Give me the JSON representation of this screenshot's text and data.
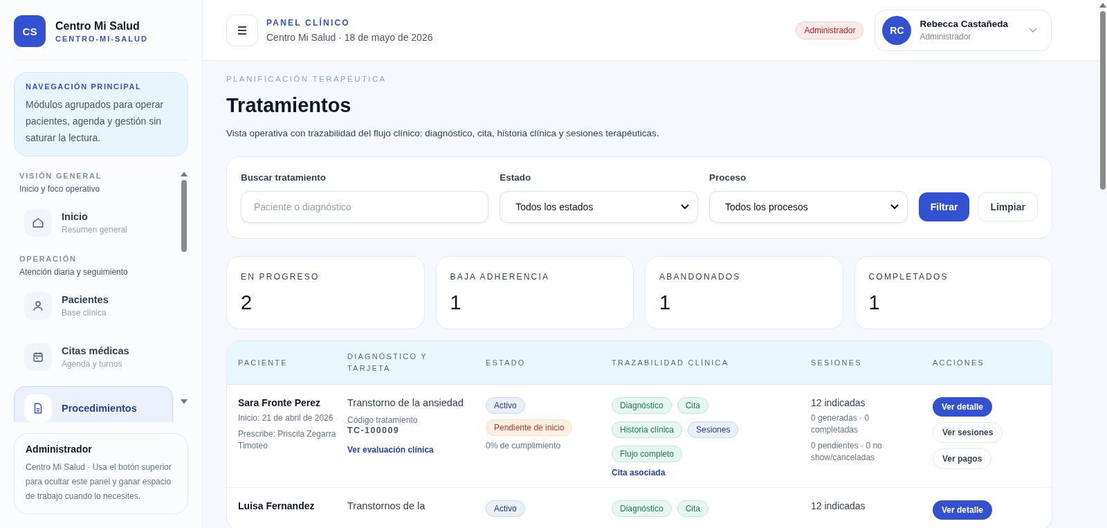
{
  "brand": {
    "initials": "CS",
    "name": "Centro Mi Salud",
    "slug": "CENTRO-MI-SALUD"
  },
  "nav_intro": {
    "title": "NAVEGACIÓN PRINCIPAL",
    "text": "Módulos agrupados para operar pacientes, agenda y gestión sin saturar la lectura."
  },
  "nav_sections": [
    {
      "title": "VISIÓN GENERAL",
      "subtitle": "Inicio y foco operativo",
      "items": [
        {
          "kind": "home",
          "label": "Inicio",
          "sub": "Resumen general",
          "selected": false
        }
      ]
    },
    {
      "title": "OPERACIÓN",
      "subtitle": "Atención diaria y seguimiento",
      "items": [
        {
          "kind": "user",
          "label": "Pacientes",
          "sub": "Base clínica",
          "selected": false
        },
        {
          "kind": "calendar",
          "label": "Citas médicas",
          "sub": "Agenda y turnos",
          "selected": false
        },
        {
          "kind": "document",
          "label": "Procedimientos",
          "selected": true
        }
      ]
    }
  ],
  "sidebar_footer": {
    "title": "Administrador",
    "text": "Centro Mi Salud · Usa el botón superior para ocultar este panel y ganar espacio de trabajo cuando lo necesites."
  },
  "header": {
    "eyebrow": "PANEL CLÍNICO",
    "subtitle": "Centro Mi Salud · 18 de mayo de 2026",
    "role_badge": "Administrador",
    "user": {
      "initials": "RC",
      "name": "Rebecca Castañeda",
      "role": "Administrador"
    }
  },
  "page": {
    "eyebrow": "PLANIFICACIÓN TERAPÉUTICA",
    "title": "Tratamientos",
    "description": "Vista operativa con trazabilidad del flujo clínico: diagnóstico, cita, historia clínica y sesiones terapéuticas."
  },
  "filters": {
    "search": {
      "label": "Buscar tratamiento",
      "placeholder": "Paciente o diagnóstico"
    },
    "selects": [
      {
        "label": "Estado",
        "value": "Todos los estados"
      },
      {
        "label": "Proceso",
        "value": "Todos los procesos"
      }
    ],
    "buttons": [
      {
        "label": "Filtrar",
        "kind": "primary"
      },
      {
        "label": "Limpiar",
        "kind": "secondary"
      }
    ]
  },
  "stats": [
    {
      "label": "EN PROGRESO",
      "value": "2"
    },
    {
      "label": "BAJA ADHERENCIA",
      "value": "1"
    },
    {
      "label": "ABANDONADOS",
      "value": "1"
    },
    {
      "label": "COMPLETADOS",
      "value": "1"
    }
  ],
  "table": {
    "columns": [
      "PACIENTE",
      "DIAGNÓSTICO Y TARJETA",
      "ESTADO",
      "TRAZABILIDAD CLÍNICA",
      "SESIONES",
      "ACCIONES"
    ],
    "rows": [
      {
        "patient": "Sara Fronte Perez",
        "start": "Inicio: 21 de abril de 2026",
        "prescriber": "Prescribe: Priscila Zegarra Timoteo",
        "diagnosis": "Transtorno de la ansiedad",
        "code_label": "Código tratamiento",
        "code": "TC-100009",
        "diagnosis_link": "Ver evaluación clínica",
        "statuses": [
          {
            "label": "Activo",
            "kind": "info"
          },
          {
            "label": "Pendiente de inicio",
            "kind": "warning"
          }
        ],
        "compliance": "0% de cumplimiento",
        "trace": [
          {
            "label": "Diagnóstico",
            "done": true
          },
          {
            "label": "Cita",
            "done": true
          },
          {
            "label": "Historia clínica",
            "done": true
          },
          {
            "label": "Sesiones",
            "done": false
          },
          {
            "label": "Flujo completo",
            "done": true
          }
        ],
        "trace_link": "Cita asociada",
        "sessions": "12 indicadas",
        "sessions_detail": [
          "0 generadas · 0 completadas",
          "0 pendientes · 0 no show/canceladas"
        ],
        "actions": [
          {
            "label": "Ver detalle",
            "kind": "primary"
          },
          {
            "label": "Ver sesiones",
            "kind": "secondary"
          },
          {
            "label": "Ver pagos",
            "kind": "secondary"
          }
        ]
      },
      {
        "patient": "Luisa Fernandez",
        "diagnosis": "Transtornos de la",
        "statuses": [
          {
            "label": "Activo",
            "kind": "info"
          }
        ],
        "trace": [
          {
            "label": "Diagnóstico",
            "done": true
          },
          {
            "label": "Cita",
            "done": true
          }
        ],
        "sessions": "12 indicadas",
        "actions": [
          {
            "label": "Ver detalle",
            "kind": "primary"
          }
        ]
      }
    ]
  }
}
